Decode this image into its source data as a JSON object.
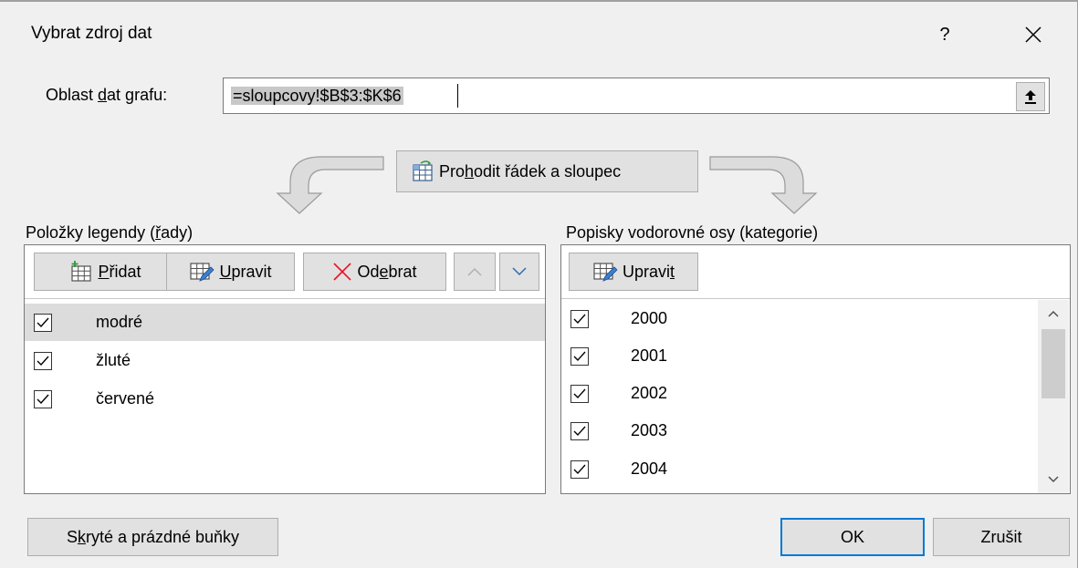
{
  "dialog": {
    "title": "Vybrat zdroj dat",
    "help_label": "?"
  },
  "range": {
    "label_pre": "Oblast ",
    "label_key": "d",
    "label_post": "at grafu:",
    "value": "=sloupcovy!$B$3:$K$6"
  },
  "switch_button": {
    "label_pre": "Pro",
    "label_key": "h",
    "label_post": "odit řádek a sloupec"
  },
  "legend": {
    "title_pre": "Položky legendy (",
    "title_key": "ř",
    "title_post": "ady)",
    "add_key": "P",
    "add_rest": "řidat",
    "edit_key": "U",
    "edit_rest": "pravit",
    "remove_pre": "Od",
    "remove_key": "e",
    "remove_post": "brat",
    "items": [
      {
        "label": "modré",
        "checked": true,
        "selected": true
      },
      {
        "label": "žluté",
        "checked": true,
        "selected": false
      },
      {
        "label": "červené",
        "checked": true,
        "selected": false
      }
    ]
  },
  "axis": {
    "title_pre": "Popisky vodorovné osy (kate",
    "title_key": "g",
    "title_post": "orie)",
    "edit_pre": "Upravi",
    "edit_key": "t",
    "items": [
      {
        "label": "2000",
        "checked": true
      },
      {
        "label": "2001",
        "checked": true
      },
      {
        "label": "2002",
        "checked": true
      },
      {
        "label": "2003",
        "checked": true
      },
      {
        "label": "2004",
        "checked": true
      }
    ]
  },
  "footer": {
    "hidden_pre": "S",
    "hidden_key": "k",
    "hidden_post": "ryté a prázdné buňky",
    "ok_label": "OK",
    "cancel_label": "Zrušit"
  },
  "colors": {
    "dialog_bg": "#f0f0f0",
    "button_bg": "#e1e1e1",
    "selected_row": "#dcdcdc",
    "ok_border": "#0078d7",
    "remove_icon": "#e81123"
  }
}
